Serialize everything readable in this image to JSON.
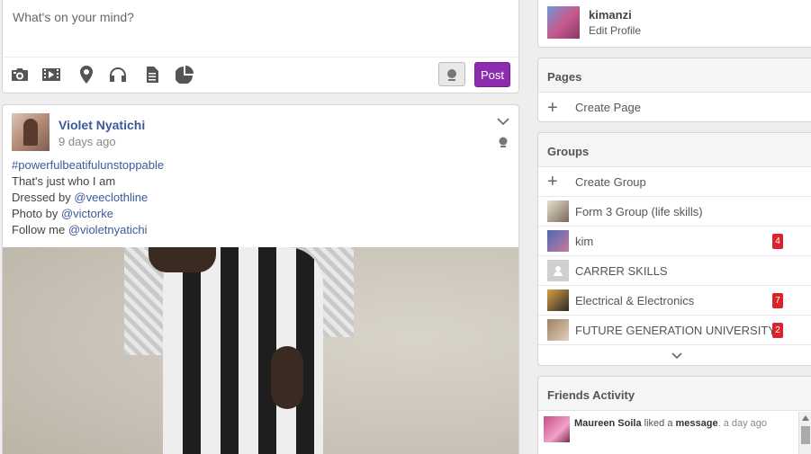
{
  "composer": {
    "placeholder": "What's on your mind?",
    "post_label": "Post",
    "tools": [
      "camera-icon",
      "video-icon",
      "location-icon",
      "headphones-icon",
      "file-icon",
      "poll-icon"
    ]
  },
  "post": {
    "author": "Violet Nyatichi",
    "time": "9 days ago",
    "hashtag": "#powerfulbeatifulunstoppable",
    "line1": "That's just who I am",
    "line2_prefix": "Dressed by ",
    "line2_link": "@veeclothline",
    "line3_prefix": "Photo by ",
    "line3_link": "@victorke",
    "line4_prefix": "Follow me ",
    "line4_link": "@violetnyatichi"
  },
  "profile": {
    "name": "kimanzi",
    "edit_label": "Edit Profile"
  },
  "pages": {
    "title": "Pages",
    "create_label": "Create Page"
  },
  "groups": {
    "title": "Groups",
    "create_label": "Create Group",
    "items": [
      {
        "name": "Form 3 Group (life skills)",
        "badge": ""
      },
      {
        "name": "kim",
        "badge": "4"
      },
      {
        "name": "CARRER SKILLS",
        "badge": ""
      },
      {
        "name": "Electrical & Electronics",
        "badge": "7"
      },
      {
        "name": "FUTURE GENERATION UNIVERSITY",
        "badge": "2"
      }
    ]
  },
  "friends": {
    "title": "Friends Activity",
    "activity_user": "Maureen Soila",
    "activity_action": " liked a ",
    "activity_object": "message",
    "activity_time": ". a day ago"
  },
  "colors": {
    "accent": "#8e2cb0",
    "link": "#3a5a9a",
    "badge": "#d9232e"
  }
}
